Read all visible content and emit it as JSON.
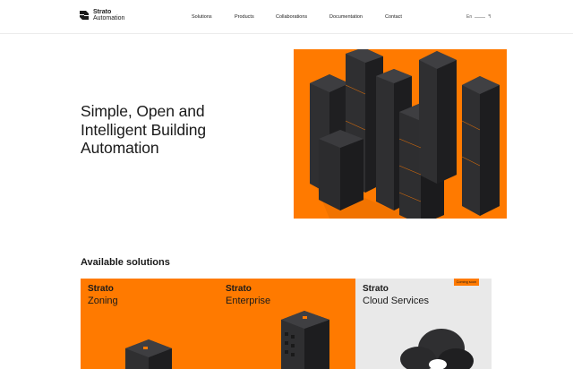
{
  "brand": {
    "line1": "Strato",
    "line2": "Automation"
  },
  "nav": {
    "items": [
      {
        "label": "Solutions"
      },
      {
        "label": "Products"
      },
      {
        "label": "Collaborations"
      },
      {
        "label": "Documentation"
      },
      {
        "label": "Contact"
      }
    ]
  },
  "language": {
    "current": "En",
    "other": "ꟻ"
  },
  "hero": {
    "title": "Simple, Open and Intelligent Building Automation"
  },
  "solutions": {
    "heading": "Available solutions",
    "cards": [
      {
        "brand": "Strato",
        "name": "Zoning"
      },
      {
        "brand": "Strato",
        "name": "Enterprise"
      },
      {
        "brand": "Strato",
        "name": "Cloud Services",
        "badge": "Coming soon"
      }
    ]
  },
  "colors": {
    "accent": "#ff7a00",
    "text": "#1a1a1a",
    "card_grey": "#e9e9e9",
    "building": "#2f2f31"
  }
}
